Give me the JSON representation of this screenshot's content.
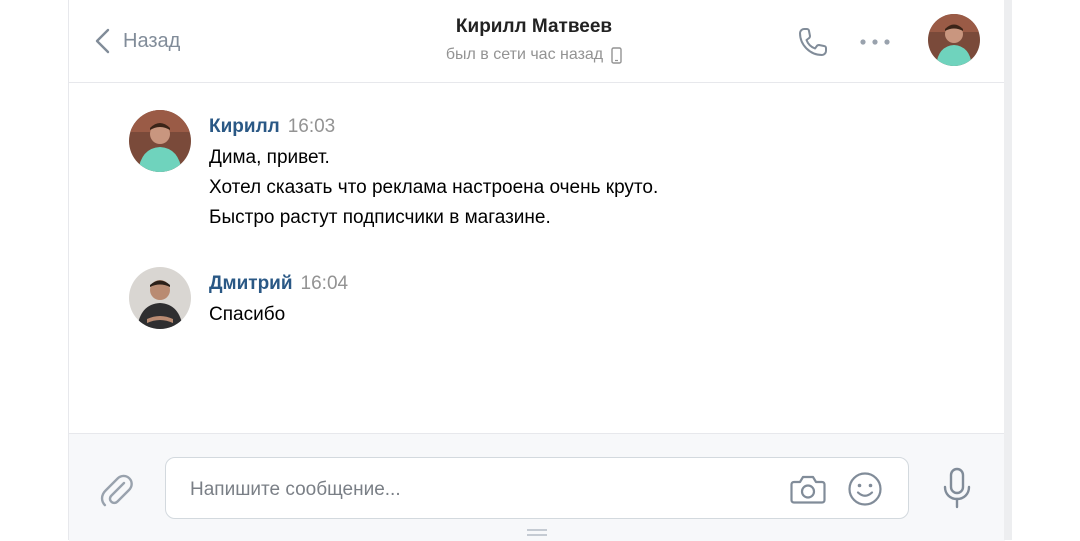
{
  "header": {
    "back_label": "Назад",
    "title": "Кирилл Матвеев",
    "subtitle": "был в сети час назад"
  },
  "messages": [
    {
      "author": "Кирилл",
      "time": "16:03",
      "lines": [
        "Дима, привет.",
        "Хотел сказать что реклама настроена очень круто.",
        "Быстро растут подписчики в магазине."
      ]
    },
    {
      "author": "Дмитрий",
      "time": "16:04",
      "lines": [
        "Спасибо"
      ]
    }
  ],
  "composer": {
    "placeholder": "Напишите сообщение...",
    "value": ""
  },
  "colors": {
    "link": "#2a5885",
    "muted": "#939393",
    "icon": "#818c99",
    "border": "#e7e8ec"
  },
  "icons": [
    "back-chevron-icon",
    "mobile-icon",
    "phone-icon",
    "more-icon",
    "paperclip-icon",
    "camera-icon",
    "smile-icon",
    "microphone-icon"
  ]
}
